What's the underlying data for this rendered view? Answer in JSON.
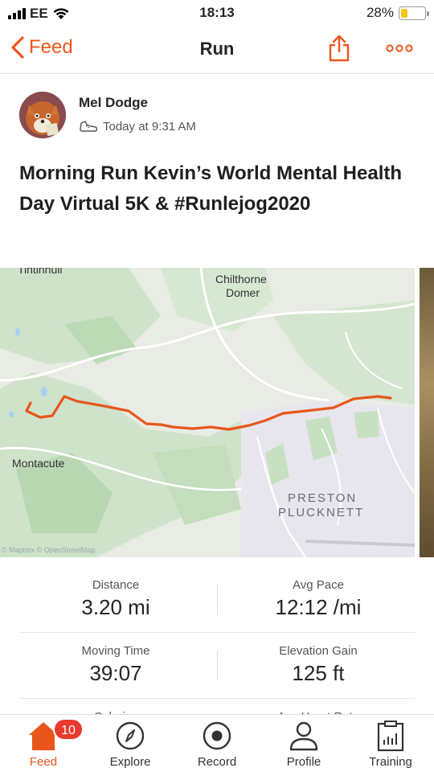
{
  "status_bar": {
    "carrier": "EE",
    "time": "18:13",
    "battery_percent": "28%",
    "battery_level": 0.28,
    "icons": [
      "signal-icon",
      "wifi-icon",
      "battery-icon"
    ]
  },
  "nav": {
    "back_label": "Feed",
    "title": "Run",
    "icons": [
      "chevron-left-icon",
      "share-icon",
      "more-icon"
    ],
    "accent_color": "#e8561c"
  },
  "athlete": {
    "name": "Mel Dodge",
    "timestamp": "Today at 9:31 AM",
    "activity_icon": "shoe-icon"
  },
  "activity": {
    "title": "Morning Run Kevin’s World Mental Health Day Virtual 5K & #Runlejog2020"
  },
  "map": {
    "labels": {
      "tintinhull": "Tintinhull",
      "chilthorne_1": "Chilthorne",
      "chilthorne_2": "Domer",
      "montacute": "Montacute",
      "preston_1": "PRESTON",
      "preston_2": "PLUCKNETT"
    },
    "attribution": "© Mapbox © OpenStreetMap",
    "route_color": "#e8561c"
  },
  "stats": {
    "distance": {
      "label": "Distance",
      "value": "3.20 mi"
    },
    "avg_pace": {
      "label": "Avg Pace",
      "value": "12:12 /mi"
    },
    "moving_time": {
      "label": "Moving Time",
      "value": "39:07"
    },
    "elevation_gain": {
      "label": "Elevation Gain",
      "value": "125 ft"
    },
    "calories": {
      "label": "Calories"
    },
    "avg_heart_rate": {
      "label": "Avg Heart Rate"
    }
  },
  "tabbar": {
    "feed": {
      "label": "Feed",
      "badge": "10"
    },
    "explore": {
      "label": "Explore"
    },
    "record": {
      "label": "Record"
    },
    "profile": {
      "label": "Profile"
    },
    "training": {
      "label": "Training"
    }
  }
}
